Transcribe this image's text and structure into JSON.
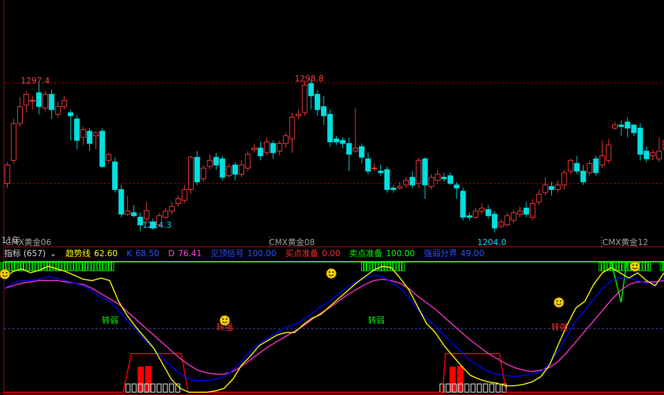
{
  "colors": {
    "up": "#ff3b3b",
    "down": "#00e0e0",
    "k_line": "#0000ff",
    "d_line": "#ff33cc",
    "trend_line": "#ffff00",
    "buy_prep": "#00ff00",
    "sell_prep": "#ff0000",
    "dash": "#b00000",
    "panel_border": "#c00000"
  },
  "price_labels": {
    "high1": "1297.4",
    "high2": "1298.8",
    "low1": "1214.3",
    "low2": "1204.0"
  },
  "contracts": {
    "left_clip": "11年",
    "c1": "CMX黄金06",
    "c2": "CMX黄金08",
    "c3": "CMX黄金12"
  },
  "indicator_bar": {
    "name": "指标 (657)",
    "trend_label": "趋势线",
    "trend_value": "62.60",
    "k_label": "K",
    "k_value": "68.50",
    "d_label": "D",
    "d_value": "76.41",
    "signal_label": "见顶信号",
    "signal_value": "100.00",
    "buy_label": "买点准备",
    "buy_value": "0.00",
    "sell_label": "卖点准备",
    "sell_value": "100.00",
    "boundary_label": "强弱分界",
    "boundary_value": "49.00"
  },
  "annotations": {
    "weak1": "转弱",
    "strong1": "转强",
    "weak2": "转弱",
    "strong2": "转强"
  },
  "chart_data": {
    "type": "candlestick",
    "price_range": [
      1195,
      1310
    ],
    "dashed_levels": [
      1297.4,
      1232.0
    ],
    "candles": [
      [
        1232,
        1244,
        1229,
        1246
      ],
      [
        1247,
        1271,
        1245,
        1274
      ],
      [
        1271,
        1282,
        1269,
        1288
      ],
      [
        1283,
        1290,
        1278,
        1292
      ],
      [
        1286,
        1286,
        1280,
        1289
      ],
      [
        1291,
        1282,
        1277,
        1297.4
      ],
      [
        1281,
        1290,
        1279,
        1292
      ],
      [
        1290,
        1280,
        1274,
        1293
      ],
      [
        1277,
        1282,
        1275,
        1285
      ],
      [
        1282,
        1286,
        1280,
        1289
      ],
      [
        1278,
        1276,
        1260,
        1280
      ],
      [
        1274,
        1260,
        1254,
        1276
      ],
      [
        1262,
        1267,
        1257,
        1269
      ],
      [
        1266,
        1258,
        1253,
        1268
      ],
      [
        1263,
        1265,
        1254,
        1266
      ],
      [
        1266,
        1243,
        1242,
        1268
      ],
      [
        1247,
        1251,
        1245,
        1252
      ],
      [
        1246,
        1228,
        1226,
        1249
      ],
      [
        1228,
        1212,
        1210,
        1231
      ],
      [
        1212,
        1214,
        1211,
        1224
      ],
      [
        1213,
        1211,
        1210,
        1218
      ],
      [
        1210,
        1205,
        1201,
        1213
      ],
      [
        1209,
        1214.3,
        1206,
        1220
      ],
      [
        1207,
        1203,
        1202,
        1209
      ],
      [
        1205,
        1211,
        1204,
        1213
      ],
      [
        1210,
        1214,
        1209,
        1216
      ],
      [
        1214,
        1217,
        1212,
        1220
      ],
      [
        1219,
        1222,
        1217,
        1224
      ],
      [
        1221,
        1228,
        1219,
        1231
      ],
      [
        1228,
        1249,
        1225,
        1250
      ],
      [
        1249,
        1233,
        1231,
        1253
      ],
      [
        1235,
        1242,
        1233,
        1244
      ],
      [
        1243,
        1247,
        1241,
        1251
      ],
      [
        1249,
        1244,
        1241,
        1252
      ],
      [
        1248,
        1236,
        1234,
        1250
      ],
      [
        1237,
        1243,
        1236,
        1245
      ],
      [
        1244,
        1238,
        1234,
        1246
      ],
      [
        1238,
        1244,
        1236,
        1247
      ],
      [
        1242,
        1251,
        1240,
        1253
      ],
      [
        1254,
        1255,
        1252,
        1258
      ],
      [
        1255,
        1250,
        1247,
        1259
      ],
      [
        1252,
        1259,
        1250,
        1262
      ],
      [
        1258,
        1252,
        1248,
        1260
      ],
      [
        1253,
        1258,
        1250,
        1260
      ],
      [
        1258,
        1263,
        1255,
        1265
      ],
      [
        1261,
        1275,
        1252,
        1278
      ],
      [
        1276,
        1277,
        1274,
        1280
      ],
      [
        1278,
        1296,
        1276,
        1298.8
      ],
      [
        1297,
        1289,
        1280,
        1299
      ],
      [
        1290,
        1280,
        1276,
        1293
      ],
      [
        1282,
        1276,
        1270,
        1289
      ],
      [
        1277,
        1259,
        1256,
        1280
      ],
      [
        1261,
        1259,
        1257,
        1263
      ],
      [
        1260,
        1258,
        1255,
        1262
      ],
      [
        1258,
        1251,
        1240,
        1262
      ],
      [
        1253,
        1255,
        1252,
        1281
      ],
      [
        1256,
        1249,
        1245,
        1258
      ],
      [
        1248,
        1240,
        1238,
        1252
      ],
      [
        1242,
        1242,
        1240,
        1245
      ],
      [
        1240,
        1239,
        1237,
        1244
      ],
      [
        1241,
        1228,
        1226,
        1243
      ],
      [
        1229,
        1228,
        1226,
        1231
      ],
      [
        1229,
        1230,
        1228,
        1233
      ],
      [
        1231,
        1234,
        1229,
        1236
      ],
      [
        1236,
        1231,
        1229,
        1240
      ],
      [
        1232,
        1247,
        1229,
        1249
      ],
      [
        1248,
        1231,
        1222,
        1249
      ],
      [
        1230,
        1236,
        1228,
        1238
      ],
      [
        1234,
        1238,
        1232,
        1241
      ],
      [
        1236,
        1235,
        1233,
        1239
      ],
      [
        1237,
        1232,
        1231,
        1239
      ],
      [
        1231,
        1229,
        1222,
        1233
      ],
      [
        1227,
        1210,
        1208,
        1229
      ],
      [
        1211,
        1210,
        1208,
        1213
      ],
      [
        1210,
        1214,
        1209,
        1216
      ],
      [
        1214,
        1216,
        1212,
        1219
      ],
      [
        1215,
        1211,
        1209,
        1218
      ],
      [
        1212,
        1203,
        1200,
        1214
      ],
      [
        1204,
        1207,
        1203,
        1209
      ],
      [
        1205,
        1211,
        1204.0,
        1213
      ],
      [
        1208,
        1213,
        1206,
        1215
      ],
      [
        1212,
        1214,
        1210,
        1217
      ],
      [
        1216,
        1212,
        1210,
        1220
      ],
      [
        1210,
        1219,
        1208,
        1222
      ],
      [
        1220,
        1225,
        1218,
        1228
      ],
      [
        1226,
        1231,
        1224,
        1236
      ],
      [
        1230,
        1228,
        1224,
        1233
      ],
      [
        1228,
        1231,
        1226,
        1234
      ],
      [
        1231,
        1239,
        1228,
        1241
      ],
      [
        1240,
        1247,
        1238,
        1248
      ],
      [
        1245,
        1240,
        1238,
        1250
      ],
      [
        1240,
        1233,
        1231,
        1244
      ],
      [
        1239,
        1245,
        1237,
        1247
      ],
      [
        1248,
        1239,
        1237,
        1250
      ],
      [
        1244,
        1250,
        1242,
        1260
      ],
      [
        1247,
        1257,
        1245,
        1261
      ],
      [
        1268,
        1270,
        1267,
        1272
      ],
      [
        1270,
        1269,
        1263,
        1273
      ],
      [
        1272,
        1268,
        1262,
        1275
      ],
      [
        1270,
        1265,
        1263,
        1268
      ],
      [
        1268,
        1251,
        1247,
        1271
      ],
      [
        1253,
        1248,
        1246,
        1256
      ],
      [
        1250,
        1252,
        1247,
        1254
      ],
      [
        1248,
        1253,
        1246,
        1262
      ],
      [
        1254,
        1260,
        1252,
        1264
      ],
      [
        1262,
        1285,
        1259,
        1290
      ]
    ],
    "indicator_range": [
      0,
      100
    ],
    "trend": [
      88,
      93,
      95,
      92,
      94,
      97,
      95,
      93,
      90,
      87,
      86,
      88,
      86,
      70,
      59,
      50,
      42,
      34,
      22,
      10,
      3,
      0,
      0,
      0,
      1,
      3,
      10,
      21,
      28,
      36,
      40,
      44,
      46,
      46,
      52,
      57,
      60,
      66,
      72,
      78,
      84,
      89,
      94,
      97,
      96,
      88,
      79,
      66,
      53,
      46,
      36,
      28,
      20,
      13,
      10,
      8,
      7,
      5,
      5,
      6,
      8,
      12,
      21,
      37,
      52,
      65,
      70,
      83,
      92,
      96,
      92,
      88,
      92,
      86,
      82,
      92
    ],
    "k_line": [
      80,
      84,
      86,
      86,
      87,
      89,
      88,
      86,
      84,
      82,
      78,
      73,
      70,
      63,
      55,
      48,
      40,
      34,
      26,
      20,
      14,
      10,
      9,
      9,
      10,
      12,
      17,
      24,
      32,
      38,
      42,
      46,
      50,
      52,
      56,
      61,
      66,
      70,
      76,
      81,
      85,
      88,
      90,
      89,
      85,
      80,
      73,
      64,
      57,
      51,
      44,
      37,
      31,
      24,
      20,
      16,
      14,
      13,
      12,
      13,
      14,
      16,
      22,
      32,
      44,
      55,
      63,
      72,
      80,
      86,
      88,
      88,
      86,
      84,
      84,
      88
    ],
    "d_line": [
      80,
      82,
      84,
      85,
      86,
      86,
      86,
      85,
      84,
      83,
      80,
      76,
      72,
      68,
      62,
      56,
      50,
      44,
      38,
      32,
      26,
      21,
      17,
      15,
      14,
      14,
      16,
      20,
      25,
      30,
      35,
      39,
      43,
      47,
      51,
      56,
      61,
      65,
      70,
      75,
      79,
      83,
      86,
      87,
      86,
      84,
      80,
      74,
      69,
      64,
      58,
      52,
      46,
      40,
      35,
      30,
      26,
      22,
      19,
      17,
      16,
      17,
      19,
      24,
      31,
      39,
      47,
      55,
      63,
      71,
      78,
      83,
      85,
      85,
      85,
      86
    ]
  }
}
